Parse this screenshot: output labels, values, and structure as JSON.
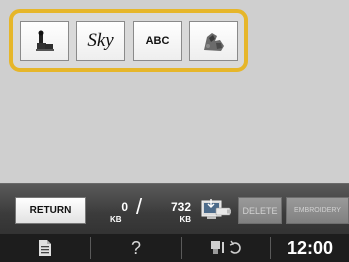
{
  "categories": {
    "items": [
      {
        "id": "one-point",
        "label": "",
        "icon": "one-point-pattern-icon"
      },
      {
        "id": "fonts",
        "label": "Sky",
        "icon": "font-sample-icon"
      },
      {
        "id": "alphabet",
        "label": "ABC",
        "icon": "alphabet-icon"
      },
      {
        "id": "saved",
        "label": "",
        "icon": "saved-pattern-icon"
      }
    ],
    "highlight_color": "#e6b62a"
  },
  "control_bar": {
    "return_label": "RETURN",
    "memory_used": "0",
    "memory_used_unit": "KB",
    "memory_separator": "/",
    "memory_total": "732",
    "memory_total_unit": "KB",
    "save_to_usb_icon": "save-to-usb-icon",
    "delete_label": "DELETE",
    "embroidery_label": "EMBROIDERY"
  },
  "status_bar": {
    "pattern_icon": "document-icon",
    "help_label": "?",
    "tension_icon": "thread-tension-icon",
    "clock": "12:00"
  }
}
